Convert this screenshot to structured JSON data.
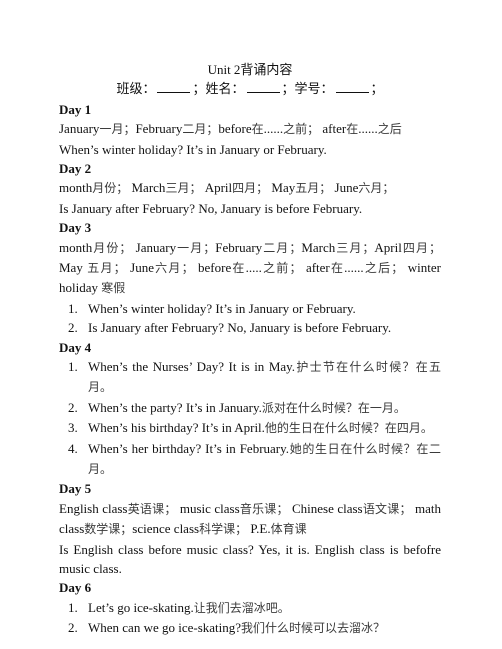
{
  "document": {
    "title": "Unit 2背诵内容",
    "info_line": {
      "class_label": "班级：",
      "name_label": "；姓名：",
      "student_no_label": "；学号：",
      "end": "；"
    },
    "days": [
      {
        "heading": "Day 1",
        "paragraphs": [
          "January一月；February二月；before在......之前； after在......之后",
          "When’s winter holiday? It’s in January or February."
        ]
      },
      {
        "heading": "Day 2",
        "paragraphs": [
          "month月份； March三月； April四月； May五月； June六月；",
          "Is January after February? No, January is before February."
        ]
      },
      {
        "heading": "Day 3",
        "paragraphs": [
          "month月份； January一月；February二月；March三月；April四月；May 五月； June六月； before在.....之前； after在......之后； winter holiday 寒假"
        ],
        "list": [
          "When’s winter holiday? It’s in January or February.",
          "Is January after February? No, January is before February."
        ]
      },
      {
        "heading": "Day 4",
        "list": [
          "When’s the Nurses’ Day? It is in May.护士节在什么时候？在五月。",
          "When’s the party? It’s in January.派对在什么时候？在一月。",
          "When’s his birthday? It’s in April.他的生日在什么时候？在四月。",
          "When’s her birthday? It’s in February.她的生日在什么时候？在二月。"
        ]
      },
      {
        "heading": "Day 5",
        "paragraphs": [
          "English class英语课； music class音乐课； Chinese class语文课； math class数学课；science class科学课； P.E.体育课",
          "Is English class before music class? Yes, it is. English class is befofre music class."
        ]
      },
      {
        "heading": "Day 6",
        "list": [
          "Let’s go ice-skating.让我们去溜冰吧。",
          "When can we go ice-skating?我们什么时候可以去溜冰？"
        ]
      }
    ]
  }
}
